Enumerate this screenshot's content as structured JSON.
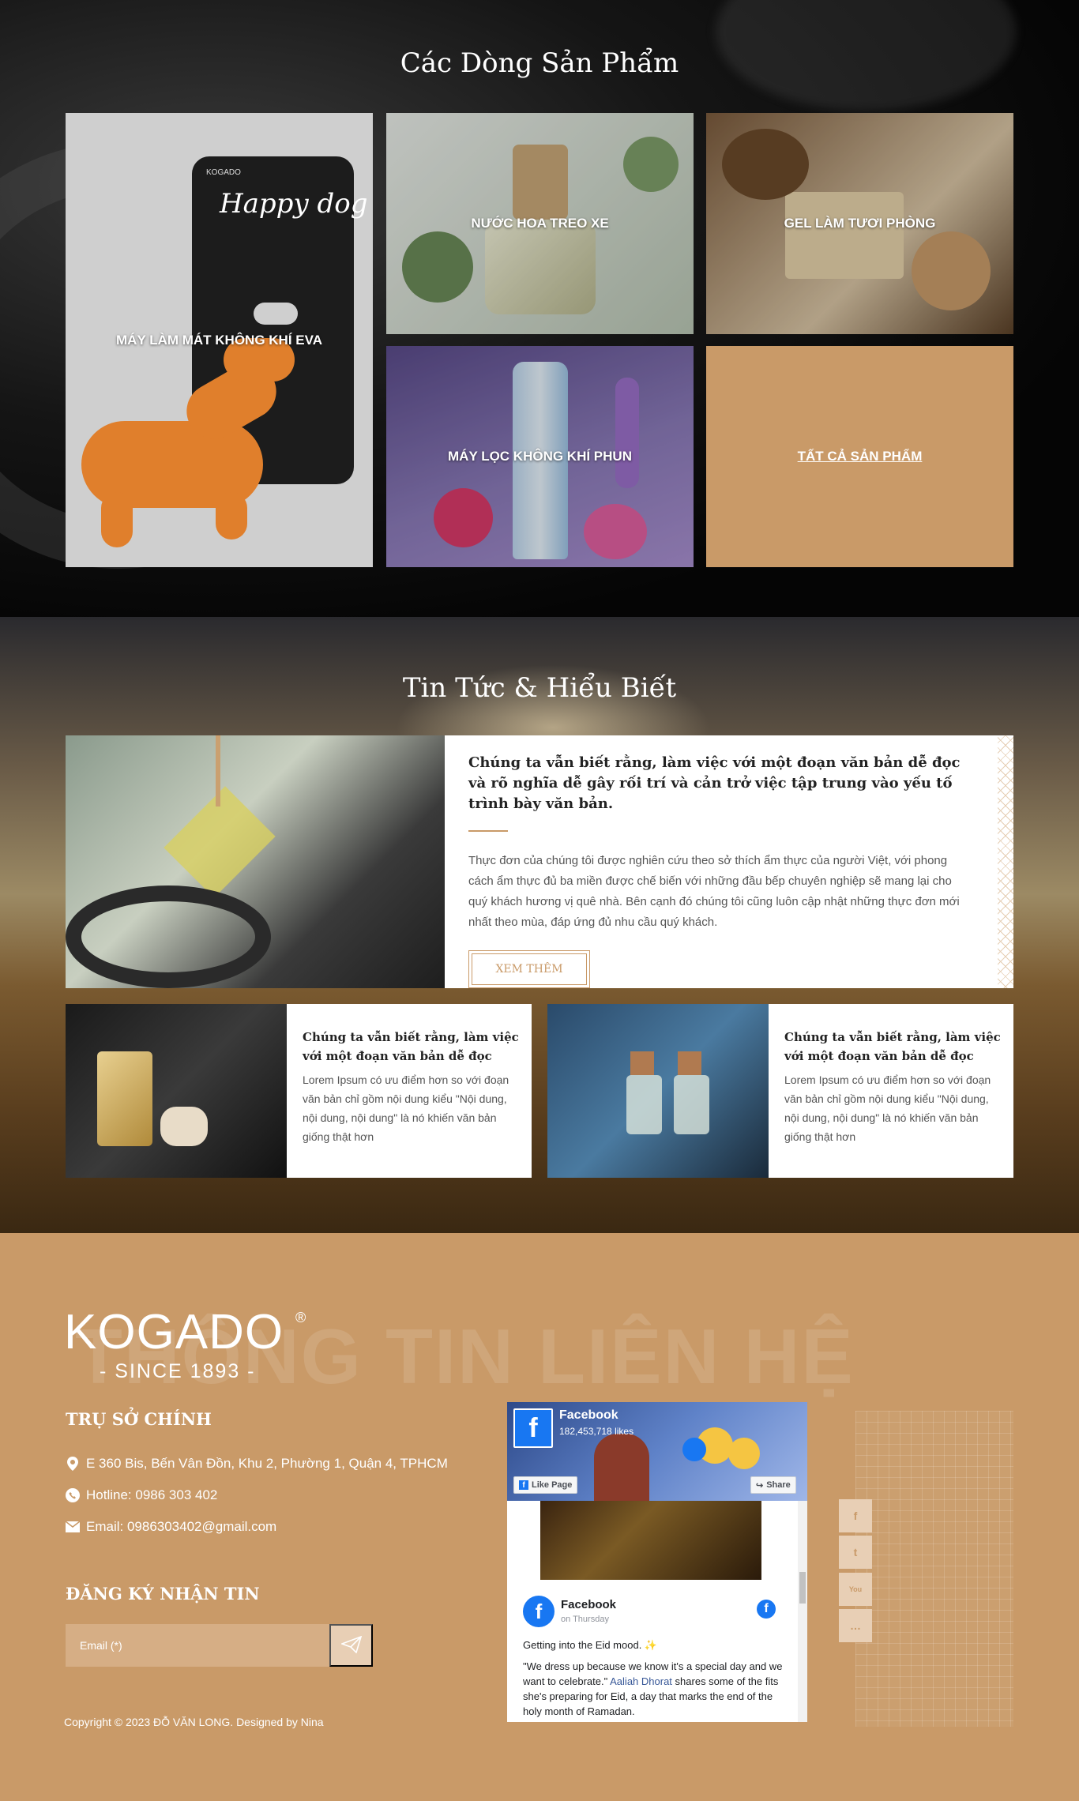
{
  "products": {
    "title": "Các Dòng Sản Phẩm",
    "items": [
      {
        "label": "MÁY LÀM MÁT KHÔNG KHÍ EVA"
      },
      {
        "label": "NƯỚC HOA TREO XE"
      },
      {
        "label": "GEL LÀM TƯƠI PHÒNG"
      },
      {
        "label": "MÁY LỌC KHÔNG KHÍ PHUN"
      },
      {
        "label": "TẤT CẢ SẢN PHẨM"
      }
    ],
    "package_brand": "KOGADO",
    "package_title": "Happy dog"
  },
  "news": {
    "title": "Tin Tức & Hiểu Biết",
    "featured": {
      "title": "Chúng ta vẫn biết rằng, làm việc với một đoạn văn bản dễ đọc và rõ nghĩa dễ gây rối trí và cản trở việc tập trung vào yếu tố trình bày văn bản.",
      "text": "Thực đơn của chúng tôi được nghiên cứu theo sở thích ẩm thực của người Việt, với phong cách ẩm thực đủ ba miền được chế biến với những đầu bếp chuyên nghiệp sẽ mang lại cho quý khách hương vị quê nhà. Bên cạnh đó chúng tôi cũng luôn cập nhật những thực đơn mới nhất theo mùa, đáp ứng đủ nhu cầu quý khách.",
      "button": "XEM THÊM"
    },
    "cards": [
      {
        "title": "Chúng ta vẫn biết rằng, làm việc với một đoạn văn bản dễ đọc",
        "text": "Lorem Ipsum có ưu điểm hơn so với đoạn văn bản chỉ gồm nội dung kiểu \"Nội dung, nội dung, nội dung\" là nó khiến văn bản giống thật hơn"
      },
      {
        "title": "Chúng ta vẫn biết rằng, làm việc với một đoạn văn bản dễ đọc",
        "text": "Lorem Ipsum có ưu điểm hơn so với đoạn văn bản chỉ gồm nội dung kiểu \"Nội dung, nội dung, nội dung\" là nó khiến văn bản giống thật hơn"
      }
    ]
  },
  "footer": {
    "watermark": "THÔNG TIN LIÊN HỆ",
    "logo": {
      "name": "KOGADO",
      "registered": "®",
      "since": "- SINCE 1893 -"
    },
    "hq_title": "TRỤ SỞ CHÍNH",
    "address": "E 360 Bis, Bến Vân Đồn, Khu 2, Phường 1, Quận 4, TPHCM",
    "hotline": "Hotline: 0986 303 402",
    "email": "Email: 0986303402@gmail.com",
    "newsletter_title": "ĐĂNG KÝ NHẬN TIN",
    "email_placeholder": "Email (*)",
    "copyright": "Copyright © 2023 ĐỖ VĂN LONG. Designed by Nina",
    "facebook": {
      "page_name": "Facebook",
      "likes": "182,453,718 likes",
      "like_page": "Like Page",
      "share": "Share",
      "post_author": "Facebook",
      "post_time": "on Thursday",
      "post_line1": "Getting into the Eid mood. ✨",
      "post_line2_a": "\"We dress up because we know it's a special day and we want to celebrate.\"",
      "post_link": "Aaliah Dhorat",
      "post_line2_b": "shares some of the fits she's preparing for Eid, a day that marks the end of the holy month of Ramadan."
    },
    "social": [
      {
        "icon": "facebook-icon",
        "glyph": "f"
      },
      {
        "icon": "twitter-icon",
        "glyph": "t"
      },
      {
        "icon": "youtube-icon",
        "glyph": "You"
      },
      {
        "icon": "chat-icon",
        "glyph": "…"
      }
    ]
  }
}
